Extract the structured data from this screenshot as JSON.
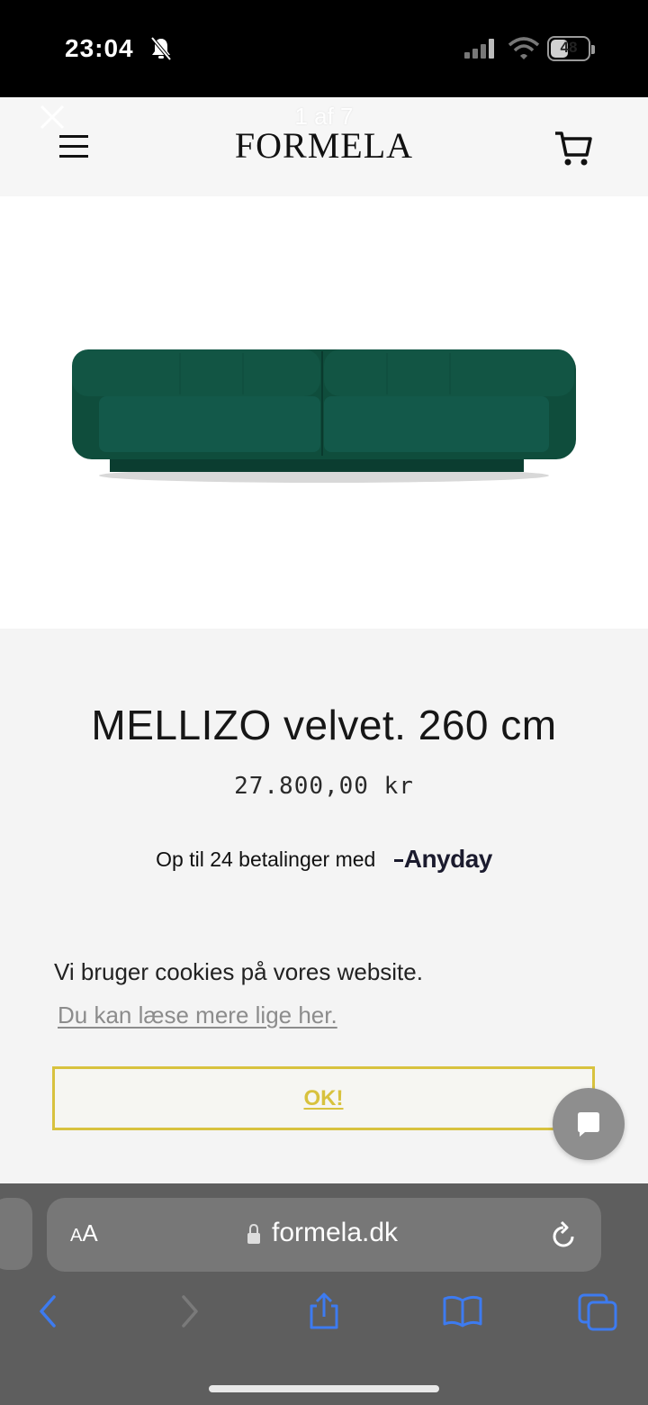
{
  "status_bar": {
    "time": "23:04",
    "battery": "48",
    "battery_level": 0.48
  },
  "header": {
    "gallery_counter": "1 af 7",
    "brand": "FORMELA"
  },
  "product": {
    "title": "MELLIZO velvet. 260 cm",
    "price": "27.800,00 kr",
    "payment_text": "Op til 24 betalinger med",
    "payment_provider": "Anyday",
    "sofa_color": "#0f4d3c"
  },
  "cookie": {
    "message": "Vi bruger cookies på vores website.",
    "link": "Du kan læse mere lige her.",
    "ok_label": "OK!",
    "accent_color": "#d8c23e"
  },
  "browser": {
    "aa_label_small": "A",
    "aa_label_large": "A",
    "url": "formela.dk",
    "toolbar_color": "#3d7bf0"
  },
  "icons": [
    "bell-slash-icon",
    "signal-icon",
    "wifi-icon",
    "close-icon",
    "menu-icon",
    "cart-icon",
    "chat-icon",
    "lock-icon",
    "reload-icon",
    "back-icon",
    "forward-icon",
    "share-icon",
    "bookmarks-icon",
    "tabs-icon"
  ]
}
